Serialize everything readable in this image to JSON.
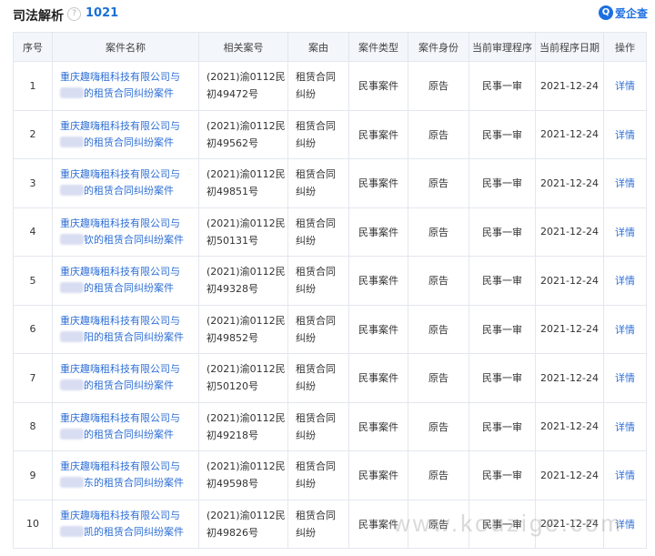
{
  "header": {
    "title": "司法解析",
    "help_glyph": "?",
    "count": "1021",
    "brand": "爱企查",
    "brand_logo_glyph": "Q"
  },
  "table": {
    "columns": [
      "序号",
      "案件名称",
      "相关案号",
      "案由",
      "案件类型",
      "案件身份",
      "当前审理程序",
      "当前程序日期",
      "操作"
    ],
    "rows": [
      {
        "index": "1",
        "name_line1": "重庆趣嗨租科技有限公司与",
        "name_line2": "的租赁合同纠纷案件",
        "case_no_line1": "(2021)渝0112民",
        "case_no_line2": "初49472号",
        "cause_line1": "租赁合同",
        "cause_line2": "纠纷",
        "type": "民事案件",
        "role": "原告",
        "stage": "民事一审",
        "date": "2021-12-24",
        "action": "详情"
      },
      {
        "index": "2",
        "name_line1": "重庆趣嗨租科技有限公司与",
        "name_line2": "的租赁合同纠纷案件",
        "case_no_line1": "(2021)渝0112民",
        "case_no_line2": "初49562号",
        "cause_line1": "租赁合同",
        "cause_line2": "纠纷",
        "type": "民事案件",
        "role": "原告",
        "stage": "民事一审",
        "date": "2021-12-24",
        "action": "详情"
      },
      {
        "index": "3",
        "name_line1": "重庆趣嗨租科技有限公司与",
        "name_line2": "的租赁合同纠纷案件",
        "case_no_line1": "(2021)渝0112民",
        "case_no_line2": "初49851号",
        "cause_line1": "租赁合同",
        "cause_line2": "纠纷",
        "type": "民事案件",
        "role": "原告",
        "stage": "民事一审",
        "date": "2021-12-24",
        "action": "详情"
      },
      {
        "index": "4",
        "name_line1": "重庆趣嗨租科技有限公司与",
        "name_line2": "钦的租赁合同纠纷案件",
        "case_no_line1": "(2021)渝0112民",
        "case_no_line2": "初50131号",
        "cause_line1": "租赁合同",
        "cause_line2": "纠纷",
        "type": "民事案件",
        "role": "原告",
        "stage": "民事一审",
        "date": "2021-12-24",
        "action": "详情"
      },
      {
        "index": "5",
        "name_line1": "重庆趣嗨租科技有限公司与",
        "name_line2": "的租赁合同纠纷案件",
        "case_no_line1": "(2021)渝0112民",
        "case_no_line2": "初49328号",
        "cause_line1": "租赁合同",
        "cause_line2": "纠纷",
        "type": "民事案件",
        "role": "原告",
        "stage": "民事一审",
        "date": "2021-12-24",
        "action": "详情"
      },
      {
        "index": "6",
        "name_line1": "重庆趣嗨租科技有限公司与",
        "name_line2": "阳的租赁合同纠纷案件",
        "case_no_line1": "(2021)渝0112民",
        "case_no_line2": "初49852号",
        "cause_line1": "租赁合同",
        "cause_line2": "纠纷",
        "type": "民事案件",
        "role": "原告",
        "stage": "民事一审",
        "date": "2021-12-24",
        "action": "详情"
      },
      {
        "index": "7",
        "name_line1": "重庆趣嗨租科技有限公司与",
        "name_line2": "的租赁合同纠纷案件",
        "case_no_line1": "(2021)渝0112民",
        "case_no_line2": "初50120号",
        "cause_line1": "租赁合同",
        "cause_line2": "纠纷",
        "type": "民事案件",
        "role": "原告",
        "stage": "民事一审",
        "date": "2021-12-24",
        "action": "详情"
      },
      {
        "index": "8",
        "name_line1": "重庆趣嗨租科技有限公司与",
        "name_line2": "的租赁合同纠纷案件",
        "case_no_line1": "(2021)渝0112民",
        "case_no_line2": "初49218号",
        "cause_line1": "租赁合同",
        "cause_line2": "纠纷",
        "type": "民事案件",
        "role": "原告",
        "stage": "民事一审",
        "date": "2021-12-24",
        "action": "详情"
      },
      {
        "index": "9",
        "name_line1": "重庆趣嗨租科技有限公司与",
        "name_line2": "东的租赁合同纠纷案件",
        "case_no_line1": "(2021)渝0112民",
        "case_no_line2": "初49598号",
        "cause_line1": "租赁合同",
        "cause_line2": "纠纷",
        "type": "民事案件",
        "role": "原告",
        "stage": "民事一审",
        "date": "2021-12-24",
        "action": "详情"
      },
      {
        "index": "10",
        "name_line1": "重庆趣嗨租科技有限公司与",
        "name_line2": "凯的租赁合同纠纷案件",
        "case_no_line1": "(2021)渝0112民",
        "case_no_line2": "初49826号",
        "cause_line1": "租赁合同",
        "cause_line2": "纠纷",
        "type": "民事案件",
        "role": "原告",
        "stage": "民事一审",
        "date": "2021-12-24",
        "action": "详情"
      }
    ]
  },
  "watermark": "www.kouzige.com",
  "colors": {
    "link": "#2f6fd6",
    "header_bg": "#f3f6fb",
    "border": "#e3e7ee",
    "count": "#1a6fd6"
  }
}
